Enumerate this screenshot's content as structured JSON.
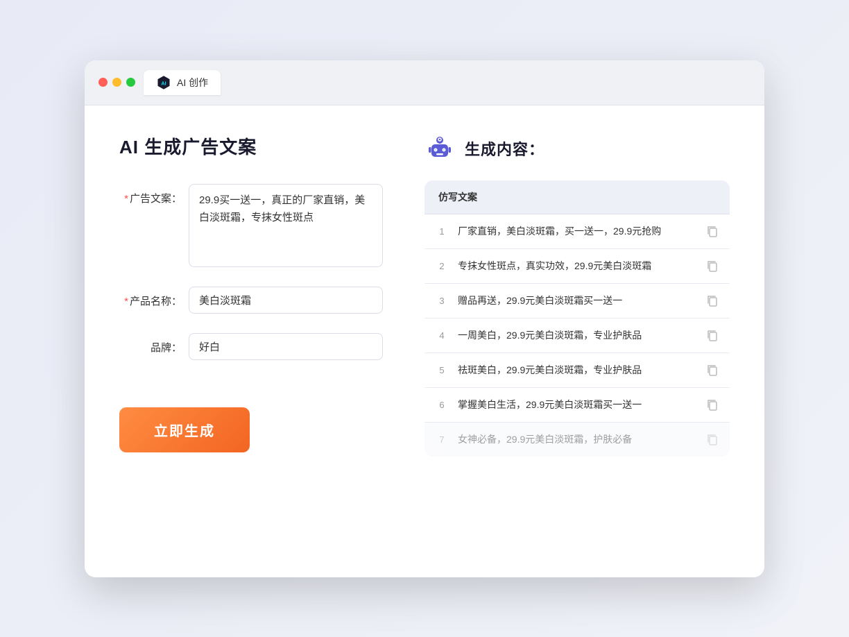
{
  "titlebar": {
    "tab_label": "AI 创作"
  },
  "left_panel": {
    "title": "AI 生成广告文案",
    "fields": [
      {
        "label": "广告文案：",
        "required": true,
        "type": "textarea",
        "value": "29.9买一送一，真正的厂家直销，美白淡斑霜，专抹女性斑点",
        "name": "ad-copy-input"
      },
      {
        "label": "产品名称：",
        "required": true,
        "type": "input",
        "value": "美白淡斑霜",
        "name": "product-name-input"
      },
      {
        "label": "品牌：",
        "required": false,
        "type": "input",
        "value": "好白",
        "name": "brand-input"
      }
    ],
    "button_label": "立即生成"
  },
  "right_panel": {
    "title": "生成内容：",
    "results_header": "仿写文案",
    "results": [
      {
        "num": "1",
        "text": "厂家直销，美白淡斑霜，买一送一，29.9元抢购",
        "faded": false
      },
      {
        "num": "2",
        "text": "专抹女性斑点，真实功效，29.9元美白淡斑霜",
        "faded": false
      },
      {
        "num": "3",
        "text": "赠品再送，29.9元美白淡斑霜买一送一",
        "faded": false
      },
      {
        "num": "4",
        "text": "一周美白，29.9元美白淡斑霜，专业护肤品",
        "faded": false
      },
      {
        "num": "5",
        "text": "祛斑美白，29.9元美白淡斑霜，专业护肤品",
        "faded": false
      },
      {
        "num": "6",
        "text": "掌握美白生活，29.9元美白淡斑霜买一送一",
        "faded": false
      },
      {
        "num": "7",
        "text": "女神必备，29.9元美白淡斑霜，护肤必备",
        "faded": true
      }
    ]
  },
  "colors": {
    "accent": "#f26522",
    "primary": "#5b5bd6",
    "required_star": "#ff4d4f"
  }
}
